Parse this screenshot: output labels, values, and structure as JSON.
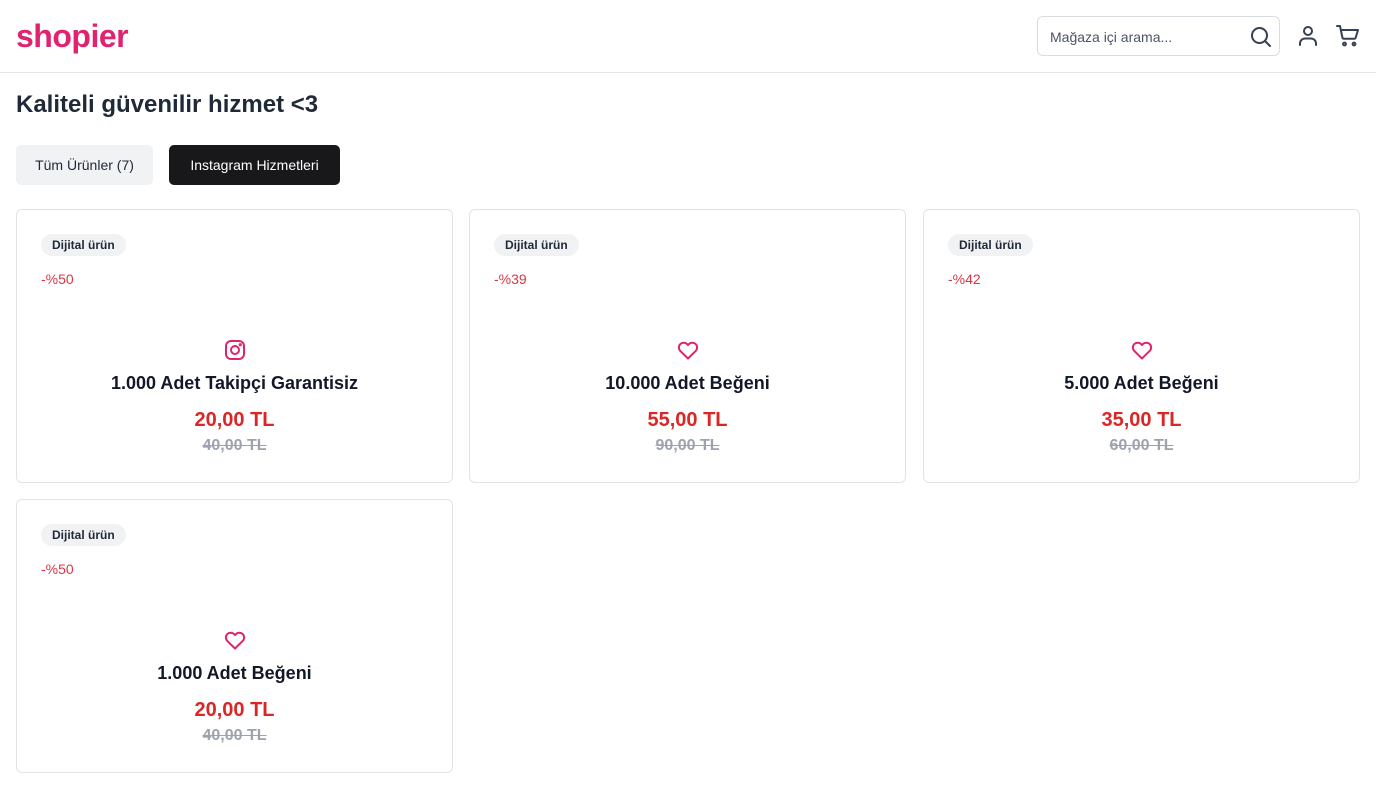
{
  "header": {
    "logo": "shopier",
    "search_placeholder": "Mağaza içi arama...",
    "icons": [
      "search-icon",
      "user-icon",
      "cart-icon"
    ]
  },
  "page": {
    "title": "Kaliteli güvenilir hizmet <3"
  },
  "filters": [
    {
      "label": "Tüm Ürünler (7)",
      "active": false
    },
    {
      "label": "Instagram Hizmetleri",
      "active": true
    }
  ],
  "products": [
    {
      "badge": "Dijital ürün",
      "discount": "-%50",
      "icon": "instagram-icon",
      "name": "1.000 Adet Takipçi Garantisiz",
      "price": "20,00 TL",
      "old_price": "40,00 TL"
    },
    {
      "badge": "Dijital ürün",
      "discount": "-%39",
      "icon": "heart-icon",
      "name": "10.000 Adet Beğeni",
      "price": "55,00 TL",
      "old_price": "90,00 TL"
    },
    {
      "badge": "Dijital ürün",
      "discount": "-%42",
      "icon": "heart-icon",
      "name": "5.000 Adet Beğeni",
      "price": "35,00 TL",
      "old_price": "60,00 TL"
    },
    {
      "badge": "Dijital ürün",
      "discount": "-%50",
      "icon": "heart-icon",
      "name": "1.000 Adet Beğeni",
      "price": "20,00 TL",
      "old_price": "40,00 TL"
    }
  ],
  "colors": {
    "brand": "#e1236f",
    "price": "#dc2626",
    "discount": "#dc3545",
    "active_filter_bg": "#18181b"
  }
}
